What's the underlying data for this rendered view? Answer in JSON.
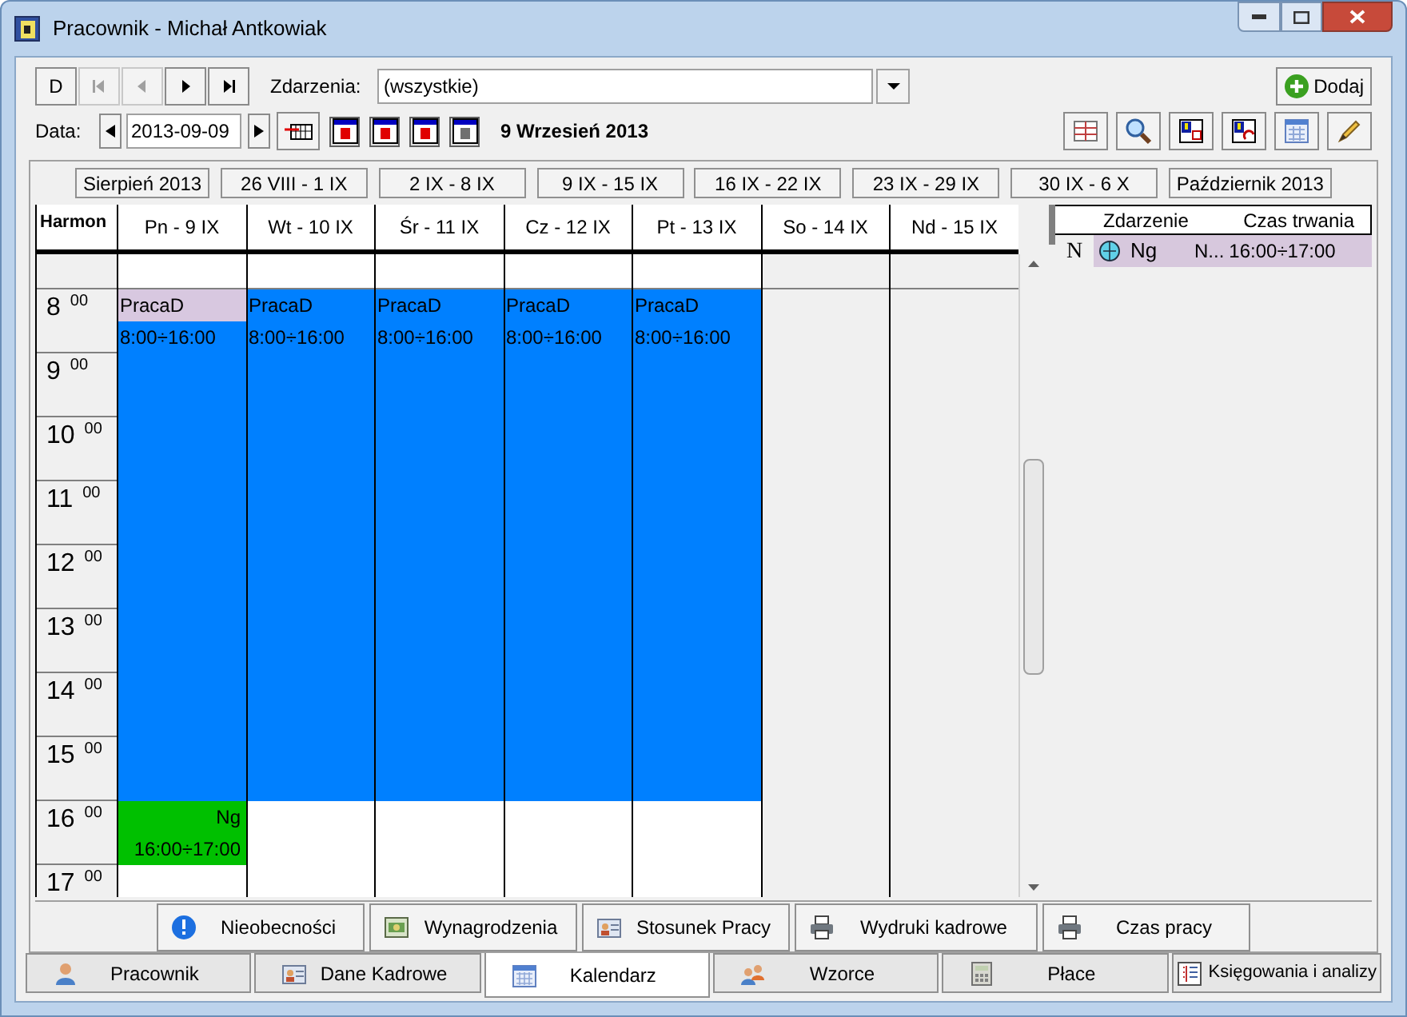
{
  "window": {
    "title": "Pracownik - Michał Antkowiak"
  },
  "nav_buttons": [
    {
      "kind": "new",
      "label": "D",
      "disabled": false
    },
    {
      "kind": "first",
      "disabled": true
    },
    {
      "kind": "prev",
      "disabled": true
    },
    {
      "kind": "next",
      "disabled": false
    },
    {
      "kind": "last",
      "disabled": false
    }
  ],
  "events_filter": {
    "label": "Zdarzenia:",
    "value": "(wszystkie)"
  },
  "add_button": "Dodaj",
  "date": {
    "label": "Data:",
    "value": "2013-09-09",
    "heading": "9 Wrzesień 2013"
  },
  "periods": [
    {
      "label": "Sierpień 2013"
    },
    {
      "label": "26 VIII - 1 IX"
    },
    {
      "label": "2 IX - 8 IX"
    },
    {
      "label": "9 IX - 15 IX"
    },
    {
      "label": "16 IX - 22 IX"
    },
    {
      "label": "23 IX - 29 IX"
    },
    {
      "label": "30 IX - 6 X"
    },
    {
      "label": "Październik 2013"
    }
  ],
  "calendar": {
    "corner": "Harmon",
    "days": [
      {
        "label": "Pn - 9 IX",
        "events": [
          {
            "kind": "work",
            "title": "PracaD",
            "time": "8:00÷16:00",
            "selected": true,
            "color": "#0080ff"
          },
          {
            "kind": "absence",
            "title": "Ng",
            "time": "16:00÷17:00",
            "selected": false,
            "color": "#00c000"
          }
        ]
      },
      {
        "label": "Wt - 10 IX",
        "events": [
          {
            "kind": "work",
            "title": "PracaD",
            "time": "8:00÷16:00",
            "selected": false,
            "color": "#0080ff"
          }
        ]
      },
      {
        "label": "Śr - 11 IX",
        "events": [
          {
            "kind": "work",
            "title": "PracaD",
            "time": "8:00÷16:00",
            "selected": false,
            "color": "#0080ff"
          }
        ]
      },
      {
        "label": "Cz - 12 IX",
        "events": [
          {
            "kind": "work",
            "title": "PracaD",
            "time": "8:00÷16:00",
            "selected": false,
            "color": "#0080ff"
          }
        ]
      },
      {
        "label": "Pt - 13 IX",
        "events": [
          {
            "kind": "work",
            "title": "PracaD",
            "time": "8:00÷16:00",
            "selected": false,
            "color": "#0080ff"
          }
        ]
      },
      {
        "label": "So - 14 IX"
      },
      {
        "label": "Nd - 15 IX"
      }
    ],
    "hours": [
      {
        "hour": "8",
        "minutes": "00"
      },
      {
        "hour": "9",
        "minutes": "00"
      },
      {
        "hour": "10",
        "minutes": "00"
      },
      {
        "hour": "11",
        "minutes": "00"
      },
      {
        "hour": "12",
        "minutes": "00"
      },
      {
        "hour": "13",
        "minutes": "00"
      },
      {
        "hour": "14",
        "minutes": "00"
      },
      {
        "hour": "15",
        "minutes": "00"
      },
      {
        "hour": "16",
        "minutes": "00"
      },
      {
        "hour": "17",
        "minutes": "00"
      }
    ]
  },
  "event_list": {
    "columns": [
      "Zdarzenie",
      "Czas trwania"
    ],
    "rows": [
      {
        "marker": "N",
        "name": "Ng",
        "type": "N...",
        "duration": "16:00÷17:00",
        "selected": true
      }
    ]
  },
  "action_buttons": [
    {
      "kind": "info",
      "label": "Nieobecności"
    },
    {
      "kind": "money",
      "label": "Wynagrodzenia"
    },
    {
      "kind": "card",
      "label": "Stosunek Pracy"
    },
    {
      "kind": "print",
      "label": "Wydruki kadrowe"
    },
    {
      "kind": "print",
      "label": "Czas pracy"
    }
  ],
  "tabs": [
    {
      "kind": "person",
      "label": "Pracownik",
      "selected": false
    },
    {
      "kind": "card",
      "label": "Dane Kadrowe",
      "selected": false
    },
    {
      "kind": "calendar",
      "label": "Kalendarz",
      "selected": true
    },
    {
      "kind": "people",
      "label": "Wzorce",
      "selected": false
    },
    {
      "kind": "calc",
      "label": "Płace",
      "selected": false
    },
    {
      "kind": "ledger",
      "label": "Księgowania i analizy",
      "selected": false
    }
  ]
}
